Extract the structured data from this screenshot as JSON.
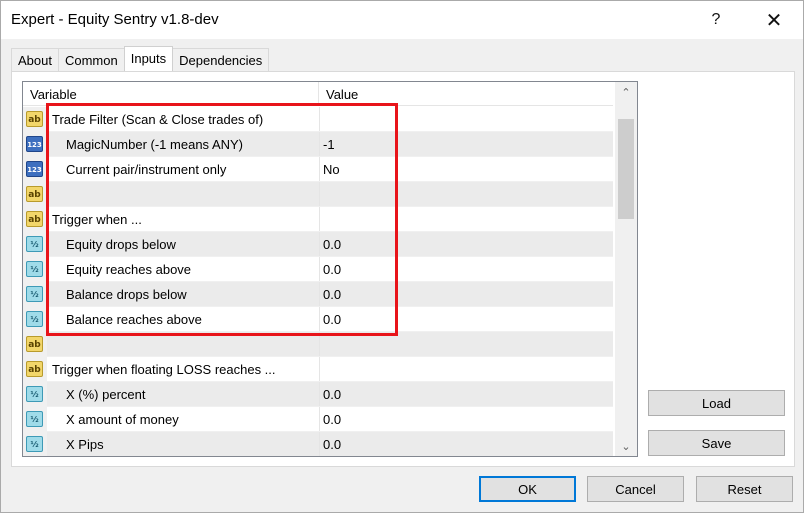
{
  "window": {
    "title": "Expert - Equity Sentry v1.8-dev",
    "help_glyph": "?",
    "close_glyph": "✕"
  },
  "tabs": [
    {
      "label": "About"
    },
    {
      "label": "Common"
    },
    {
      "label": "Inputs",
      "active": true
    },
    {
      "label": "Dependencies"
    }
  ],
  "grid": {
    "headers": {
      "variable": "Variable",
      "value": "Value"
    },
    "rows": [
      {
        "icon": "ab",
        "icon_name": "string-type-icon",
        "variable": "Trade Filter (Scan & Close trades of)",
        "value": "",
        "indent": false
      },
      {
        "icon": "123",
        "icon_name": "integer-type-icon",
        "variable": "MagicNumber (-1 means ANY)",
        "value": "-1",
        "indent": true
      },
      {
        "icon": "123",
        "icon_name": "integer-type-icon",
        "variable": "Current pair/instrument only",
        "value": "No",
        "indent": true
      },
      {
        "icon": "ab",
        "icon_name": "string-type-icon",
        "variable": "",
        "value": "",
        "indent": false
      },
      {
        "icon": "ab",
        "icon_name": "string-type-icon",
        "variable": "Trigger when ...",
        "value": "",
        "indent": false
      },
      {
        "icon": "½",
        "icon_name": "double-type-icon",
        "variable": "Equity drops below",
        "value": "0.0",
        "indent": true
      },
      {
        "icon": "½",
        "icon_name": "double-type-icon",
        "variable": "Equity reaches above",
        "value": "0.0",
        "indent": true
      },
      {
        "icon": "½",
        "icon_name": "double-type-icon",
        "variable": "Balance drops below",
        "value": "0.0",
        "indent": true
      },
      {
        "icon": "½",
        "icon_name": "double-type-icon",
        "variable": "Balance reaches above",
        "value": "0.0",
        "indent": true
      },
      {
        "icon": "ab",
        "icon_name": "string-type-icon",
        "variable": "",
        "value": "",
        "indent": false
      },
      {
        "icon": "ab",
        "icon_name": "string-type-icon",
        "variable": "Trigger when floating LOSS reaches ...",
        "value": "",
        "indent": false
      },
      {
        "icon": "½",
        "icon_name": "double-type-icon",
        "variable": "X (%) percent",
        "value": "0.0",
        "indent": true
      },
      {
        "icon": "½",
        "icon_name": "double-type-icon",
        "variable": "X amount of money",
        "value": "0.0",
        "indent": true
      },
      {
        "icon": "½",
        "icon_name": "double-type-icon",
        "variable": "X Pips",
        "value": "0.0",
        "indent": true
      }
    ]
  },
  "scrollbar": {
    "up_glyph": "⌃",
    "down_glyph": "⌄"
  },
  "buttons": {
    "load": "Load",
    "save": "Save",
    "ok": "OK",
    "cancel": "Cancel",
    "reset": "Reset"
  },
  "colors": {
    "highlight": "#e8141a",
    "ok_border": "#0078d7"
  }
}
